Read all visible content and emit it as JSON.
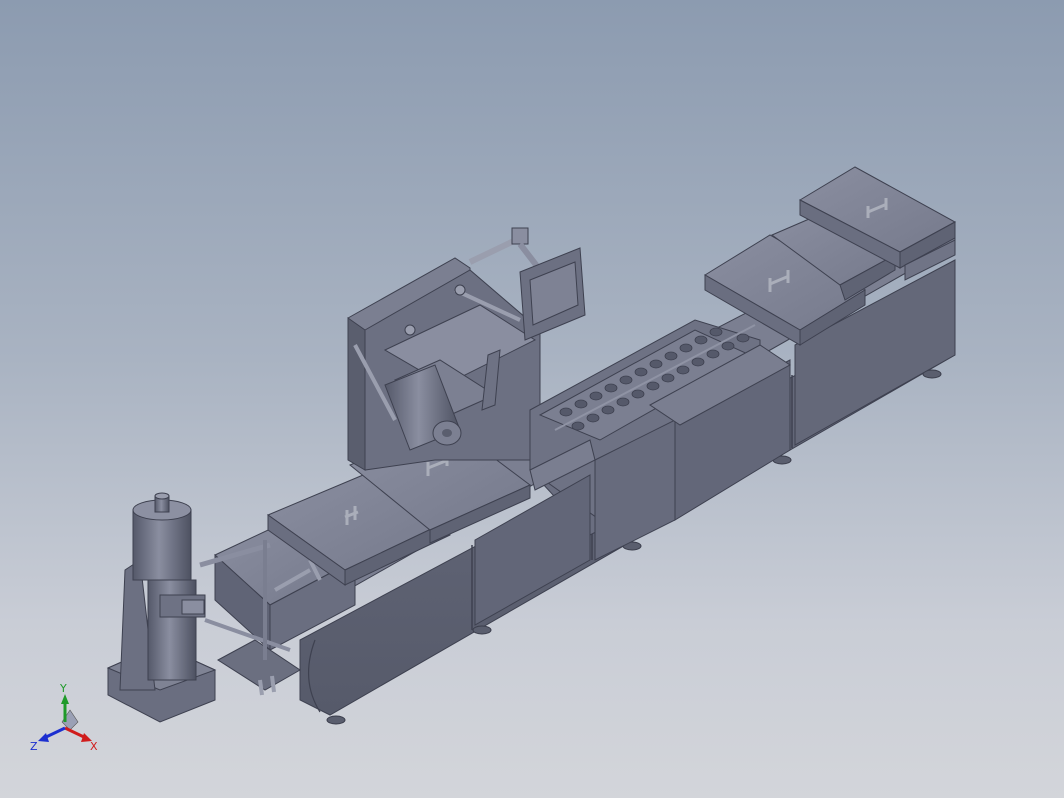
{
  "viewport": {
    "background_top": "#8c9bb0",
    "background_bottom": "#d3d5da",
    "model_color": "#6e7284"
  },
  "triad": {
    "x_label": "X",
    "y_label": "Y",
    "z_label": "Z",
    "x_color": "#d01c1c",
    "y_color": "#1f9a2a",
    "z_color": "#1c2fd0"
  }
}
